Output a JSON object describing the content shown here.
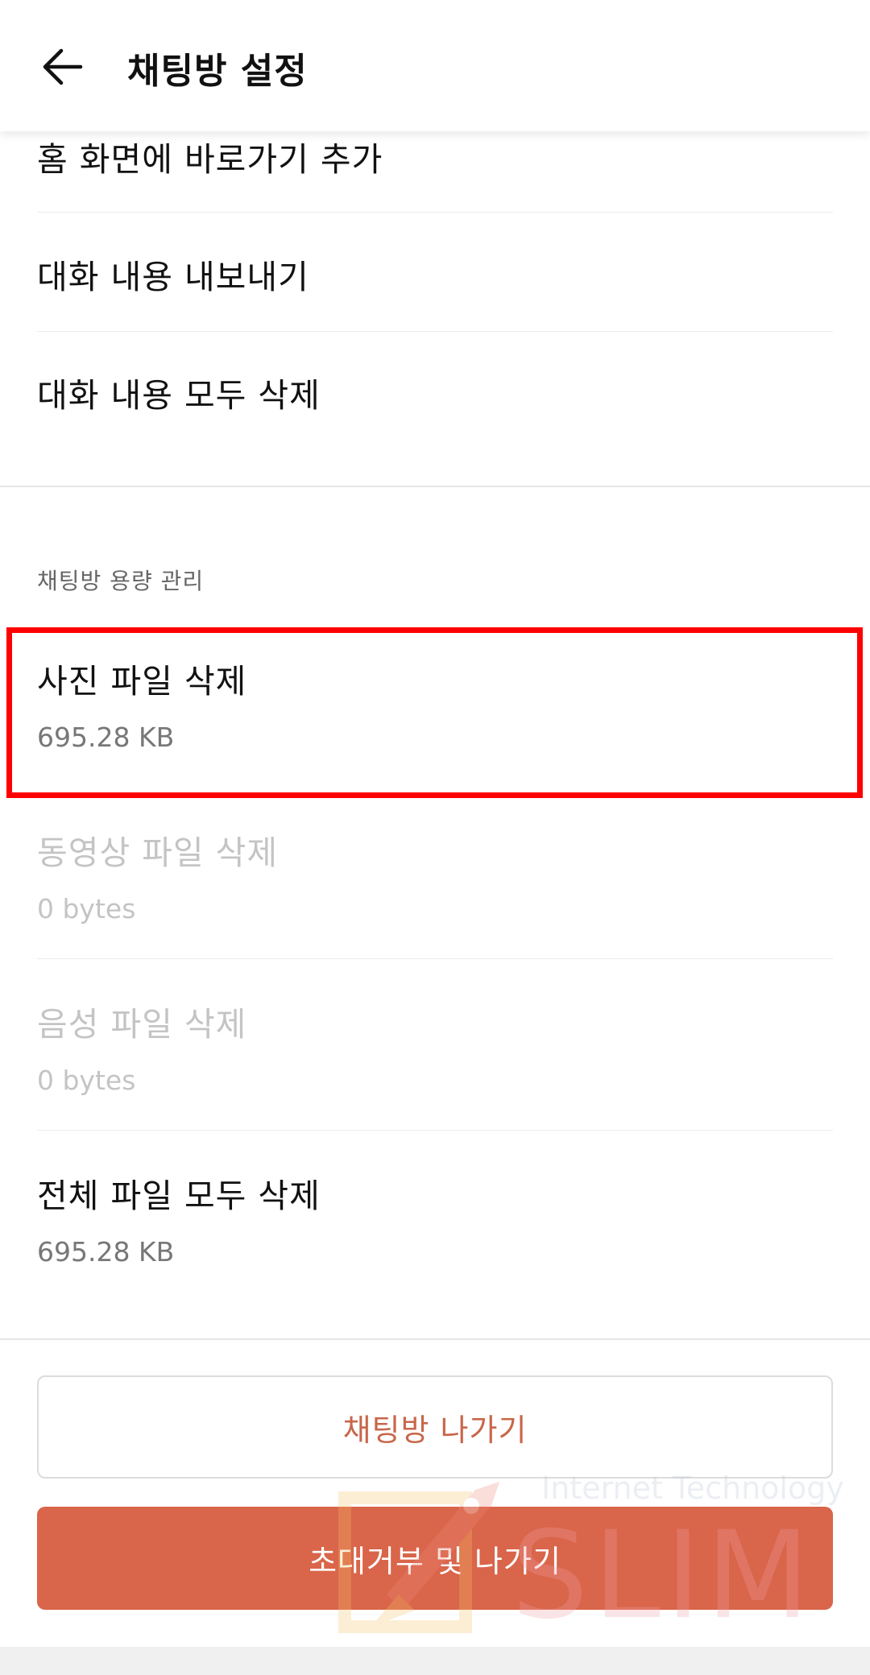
{
  "header": {
    "title": "채팅방 설정",
    "back_icon": "arrow-left-icon"
  },
  "menu": {
    "items": [
      {
        "label": "홈 화면에 바로가기 추가"
      },
      {
        "label": "대화 내용 내보내기"
      },
      {
        "label": "대화 내용 모두 삭제"
      }
    ]
  },
  "storage": {
    "section_label": "채팅방 용량 관리",
    "items": [
      {
        "title": "사진 파일 삭제",
        "size": "695.28 KB",
        "enabled": true
      },
      {
        "title": "동영상 파일 삭제",
        "size": "0 bytes",
        "enabled": false
      },
      {
        "title": "음성 파일 삭제",
        "size": "0 bytes",
        "enabled": false
      },
      {
        "title": "전체 파일 모두 삭제",
        "size": "695.28 KB",
        "enabled": true
      }
    ]
  },
  "buttons": {
    "leave_label": "채팅방 나가기",
    "block_leave_label": "초대거부 및 나가기"
  },
  "watermark": {
    "top_text": "Internet Technology",
    "big_text": "SLIM"
  },
  "colors": {
    "accent": "#d9654a",
    "accent_text": "#c8664a",
    "highlight": "#ff0000"
  }
}
